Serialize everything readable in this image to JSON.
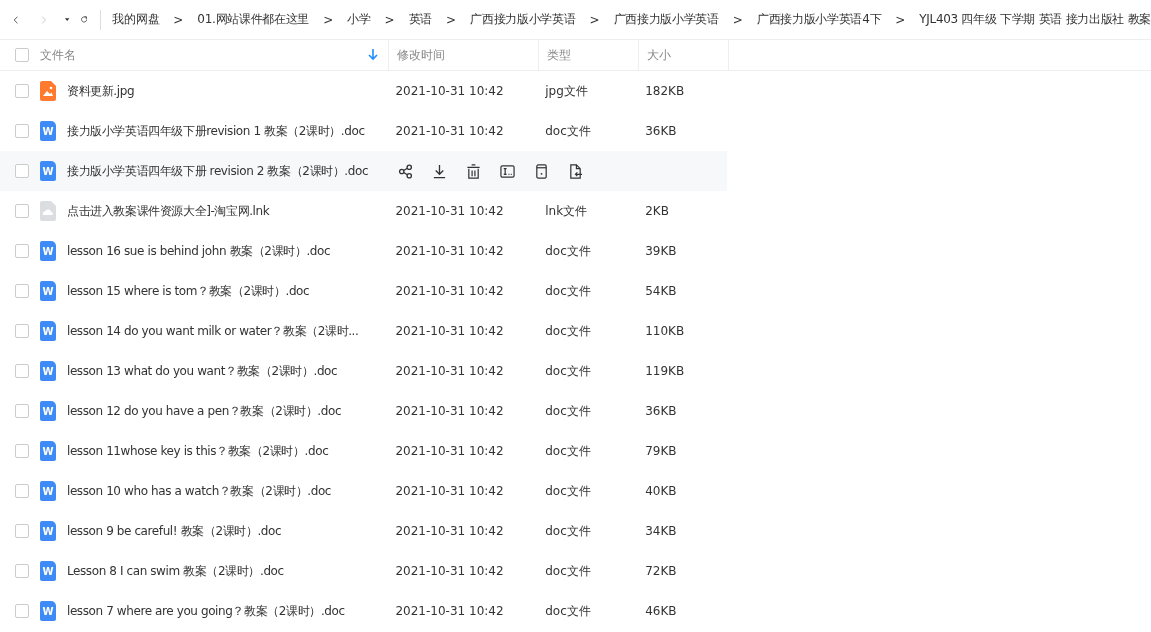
{
  "toolbar": {
    "breadcrumb": [
      "我的网盘",
      "01.网站课件都在这里",
      "小学",
      "英语",
      "广西接力版小学英语",
      "广西接力版小学英语",
      "广西接力版小学英语4下",
      "YJL403 四年级 下学期 英语 接力出版社 教案"
    ],
    "separator": ">"
  },
  "table": {
    "select_all_checked": false,
    "columns": [
      "文件名",
      "修改时间",
      "类型",
      "大小"
    ],
    "rows": [
      {
        "kind": "image",
        "name": "资料更新.jpg",
        "modified": "2021-10-31 10:42",
        "type": "jpg文件",
        "size": "182KB",
        "hovered": false,
        "checked": false
      },
      {
        "kind": "doc",
        "badge": "W",
        "name": "接力版小学英语四年级下册revision 1 教案（2课时）.doc",
        "modified": "2021-10-31 10:42",
        "type": "doc文件",
        "size": "36KB",
        "hovered": false,
        "checked": false
      },
      {
        "kind": "doc",
        "badge": "W",
        "name": "接力版小学英语四年级下册 revision 2 教案（2课时）.doc",
        "hovered": true,
        "checked": false
      },
      {
        "kind": "link",
        "name": "点击进入教案课件资源大全]-淘宝网.lnk",
        "modified": "2021-10-31 10:42",
        "type": "lnk文件",
        "size": "2KB",
        "hovered": false,
        "checked": false
      },
      {
        "kind": "doc",
        "badge": "W",
        "name": "lesson 16 sue is behind john 教案（2课时）.doc",
        "modified": "2021-10-31 10:42",
        "type": "doc文件",
        "size": "39KB",
        "hovered": false,
        "checked": false
      },
      {
        "kind": "doc",
        "badge": "W",
        "name": "lesson 15 where is tom？教案（2课时）.doc",
        "modified": "2021-10-31 10:42",
        "type": "doc文件",
        "size": "54KB",
        "hovered": false,
        "checked": false
      },
      {
        "kind": "doc",
        "badge": "W",
        "name": "lesson 14 do you want milk or water？教案（2课时...",
        "modified": "2021-10-31 10:42",
        "type": "doc文件",
        "size": "110KB",
        "hovered": false,
        "checked": false
      },
      {
        "kind": "doc",
        "badge": "W",
        "name": "lesson 13 what do you want？教案（2课时）.doc",
        "modified": "2021-10-31 10:42",
        "type": "doc文件",
        "size": "119KB",
        "hovered": false,
        "checked": false
      },
      {
        "kind": "doc",
        "badge": "W",
        "name": "lesson 12 do you have a pen？教案（2课时）.doc",
        "modified": "2021-10-31 10:42",
        "type": "doc文件",
        "size": "36KB",
        "hovered": false,
        "checked": false
      },
      {
        "kind": "doc",
        "badge": "W",
        "name": "lesson 11whose key is this？教案（2课时）.doc",
        "modified": "2021-10-31 10:42",
        "type": "doc文件",
        "size": "79KB",
        "hovered": false,
        "checked": false
      },
      {
        "kind": "doc",
        "badge": "W",
        "name": "lesson 10 who has a watch？教案（2课时）.doc",
        "modified": "2021-10-31 10:42",
        "type": "doc文件",
        "size": "40KB",
        "hovered": false,
        "checked": false
      },
      {
        "kind": "doc",
        "badge": "W",
        "name": "lesson 9 be careful! 教案（2课时）.doc",
        "modified": "2021-10-31 10:42",
        "type": "doc文件",
        "size": "34KB",
        "hovered": false,
        "checked": false
      },
      {
        "kind": "doc",
        "badge": "W",
        "name": "Lesson 8 I can swim 教案（2课时）.doc",
        "modified": "2021-10-31 10:42",
        "type": "doc文件",
        "size": "72KB",
        "hovered": false,
        "checked": false
      },
      {
        "kind": "doc",
        "badge": "W",
        "name": "lesson 7 where are you going？教案（2课时）.doc",
        "modified": "2021-10-31 10:42",
        "type": "doc文件",
        "size": "46KB",
        "hovered": false,
        "checked": false
      }
    ]
  }
}
